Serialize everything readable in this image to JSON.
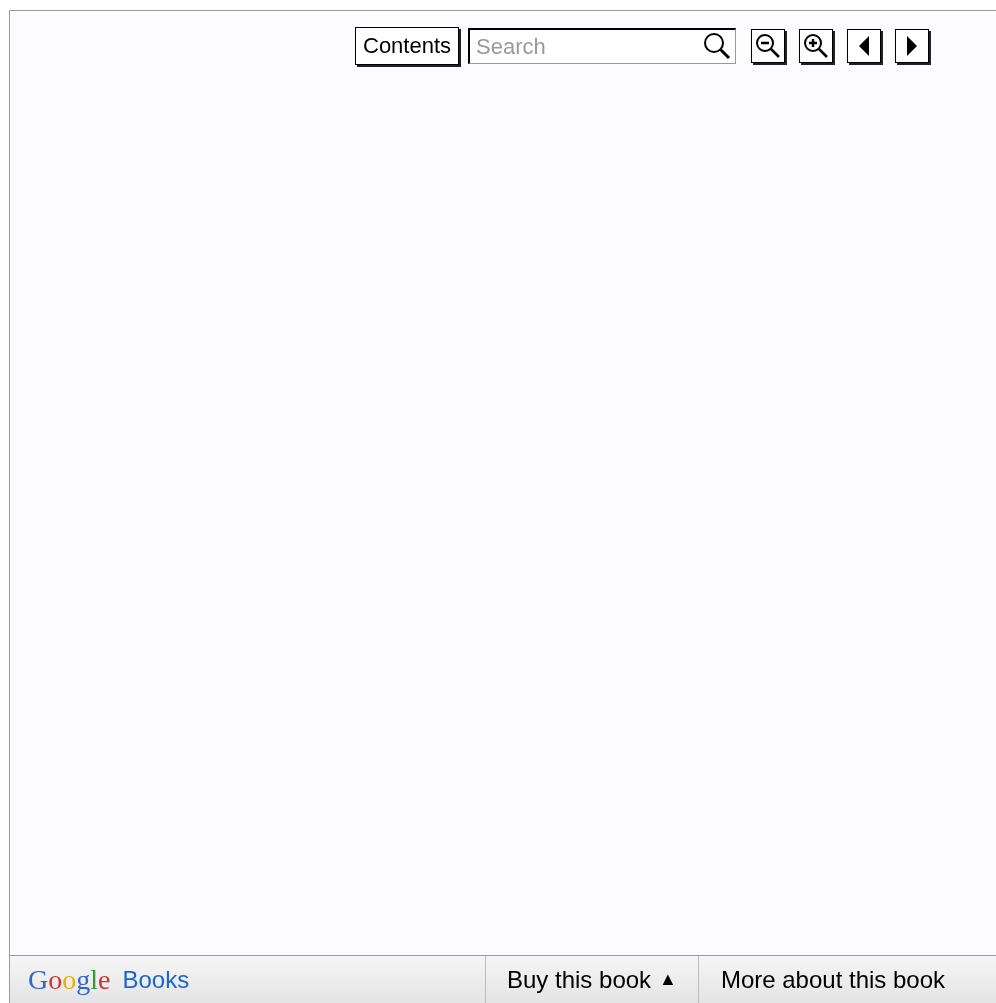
{
  "toolbar": {
    "contents_button": "Contents",
    "search": {
      "placeholder": "Search"
    }
  },
  "footer": {
    "logo": "Google",
    "brand": "Books",
    "buy_button": {
      "label": "Buy this book",
      "caret": "▲"
    },
    "more_button": "More about this book"
  }
}
